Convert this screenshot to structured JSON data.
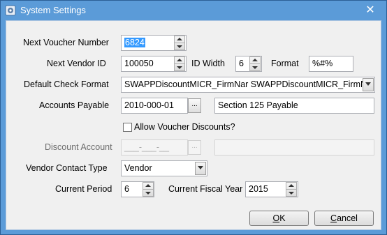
{
  "window": {
    "title": "System Settings",
    "close_glyph": "✕",
    "icon": "gear-icon"
  },
  "labels": {
    "next_voucher_number": "Next Voucher Number",
    "next_vendor_id": "Next Vendor ID",
    "id_width": "ID Width",
    "format": "Format",
    "default_check_format": "Default Check Format",
    "accounts_payable": "Accounts Payable",
    "allow_voucher_discounts": "Allow Voucher Discounts?",
    "discount_account": "Discount Account",
    "vendor_contact_type": "Vendor Contact Type",
    "current_period": "Current Period",
    "current_fiscal_year": "Current Fiscal Year"
  },
  "values": {
    "next_voucher_number": "6824",
    "next_vendor_id": "100050",
    "id_width": "6",
    "format": "%#%",
    "default_check_format": "SWAPPDiscountMICR_FirmNar SWAPPDiscountMICR_FirmNa",
    "accounts_payable": "2010-000-01",
    "accounts_payable_desc": "Section 125 Payable",
    "discount_account": "___-___-__",
    "discount_account_desc": "",
    "vendor_contact_type": "Vendor",
    "current_period": "6",
    "current_fiscal_year": "2015",
    "allow_voucher_discounts": false
  },
  "buttons": {
    "ok_mnemonic": "O",
    "ok_rest": "K",
    "cancel_mnemonic": "C",
    "cancel_rest": "ancel",
    "ellipsis": "..."
  },
  "colors": {
    "title_bar": "#5b9bd8",
    "selection": "#3399ff"
  }
}
